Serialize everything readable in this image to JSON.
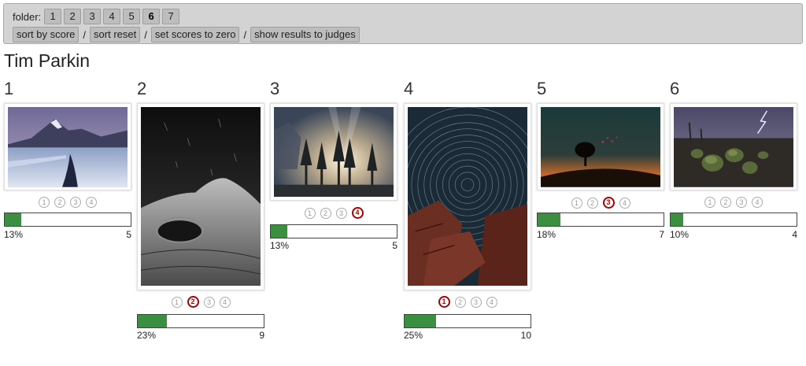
{
  "toolbar": {
    "folder_label": "folder:",
    "folders": [
      "1",
      "2",
      "3",
      "4",
      "5",
      "6",
      "7"
    ],
    "active_folder": "6",
    "actions": [
      "sort by score",
      "sort reset",
      "set scores to zero",
      "show results to judges"
    ],
    "separator": "/"
  },
  "photographer": "Tim Parkin",
  "colors": {
    "accent_fill": "#3a9040",
    "selected_score": "#aa0000",
    "toolbar_bg": "#d3d3d3"
  },
  "entries": [
    {
      "number": "1",
      "scores": [
        "1",
        "2",
        "3",
        "4"
      ],
      "selected": null,
      "percent": "13%",
      "percent_value": 13,
      "count": "5",
      "image_subject": "snowy mountain river at dusk"
    },
    {
      "number": "2",
      "scores": [
        "1",
        "2",
        "3",
        "4"
      ],
      "selected": "2",
      "percent": "23%",
      "percent_value": 23,
      "count": "9",
      "image_subject": "black and white rock formation with star trails"
    },
    {
      "number": "3",
      "scores": [
        "1",
        "2",
        "3",
        "4"
      ],
      "selected": "4",
      "percent": "13%",
      "percent_value": 13,
      "count": "5",
      "image_subject": "sunbeams through misty forest"
    },
    {
      "number": "4",
      "scores": [
        "1",
        "2",
        "3",
        "4"
      ],
      "selected": "1",
      "percent": "25%",
      "percent_value": 25,
      "count": "10",
      "image_subject": "circular star trails over red rocks"
    },
    {
      "number": "5",
      "scores": [
        "1",
        "2",
        "3",
        "4"
      ],
      "selected": "3",
      "percent": "18%",
      "percent_value": 18,
      "count": "7",
      "image_subject": "lone tree silhouette at night"
    },
    {
      "number": "6",
      "scores": [
        "1",
        "2",
        "3",
        "4"
      ],
      "selected": null,
      "percent": "10%",
      "percent_value": 10,
      "count": "4",
      "image_subject": "cactus field under lightning storm"
    }
  ]
}
